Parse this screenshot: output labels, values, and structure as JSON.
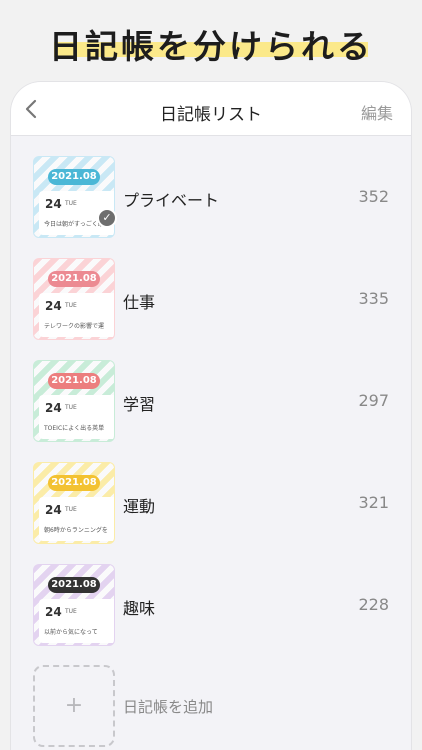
{
  "hero": {
    "title": "日記帳を分けられる"
  },
  "navbar": {
    "title": "日記帳リスト",
    "edit_label": "編集"
  },
  "diaries": [
    {
      "name": "プライベート",
      "count": "352",
      "date": "2021.08",
      "day": "24",
      "dow": "TUE",
      "line": "今日は朝がすっごく眠",
      "color": "#4bb7d6",
      "bg": "#c9e8f5",
      "selected": true
    },
    {
      "name": "仕事",
      "count": "335",
      "date": "2021.08",
      "day": "24",
      "dow": "TUE",
      "line": "テレワークの影響で運",
      "color": "#ec8a92",
      "bg": "#fbd3d6",
      "selected": false
    },
    {
      "name": "学習",
      "count": "297",
      "date": "2021.08",
      "day": "24",
      "dow": "TUE",
      "line": "TOEICによく出る英単",
      "color": "#ec7e7e",
      "bg": "#c8ecd8",
      "selected": false
    },
    {
      "name": "運動",
      "count": "321",
      "date": "2021.08",
      "day": "24",
      "dow": "TUE",
      "line": "朝6時からランニングを",
      "color": "#f3c232",
      "bg": "#fbeca8",
      "selected": false
    },
    {
      "name": "趣味",
      "count": "228",
      "date": "2021.08",
      "day": "24",
      "dow": "TUE",
      "line": "以前から気になって",
      "color": "#333333",
      "bg": "#e3d3f0",
      "selected": false
    }
  ],
  "add": {
    "label": "日記帳を追加",
    "plus": "+"
  }
}
